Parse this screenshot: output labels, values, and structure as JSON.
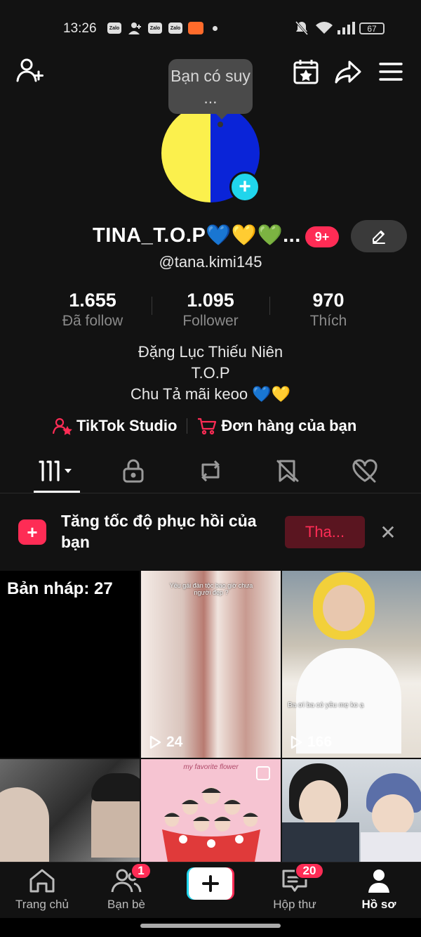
{
  "status_bar": {
    "time": "13:26",
    "apps": [
      "Zalo",
      "Zalo",
      "Zalo"
    ],
    "battery": "67"
  },
  "tooltip": {
    "text": "Bạn có suy ..."
  },
  "profile": {
    "username": "TINA_T.O.P💙💛💚...",
    "notification_badge": "9+",
    "handle": "@tana.kimi145",
    "avatar_colors": [
      "#fbf04d",
      "#0a24d8"
    ]
  },
  "stats": [
    {
      "value": "1.655",
      "label": "Đã follow"
    },
    {
      "value": "1.095",
      "label": "Follower"
    },
    {
      "value": "970",
      "label": "Thích"
    }
  ],
  "bio": [
    "Đặng Lục Thiếu Niên",
    "T.O.P",
    "Chu Tả mãi keoo 💙💛"
  ],
  "links": {
    "studio": "TikTok Studio",
    "orders": "Đơn hàng của bạn"
  },
  "tabs": [
    {
      "icon": "grid-icon",
      "active": true
    },
    {
      "icon": "lock-icon",
      "active": false
    },
    {
      "icon": "repost-icon",
      "active": false
    },
    {
      "icon": "bookmark-icon",
      "active": false
    },
    {
      "icon": "liked-icon",
      "active": false
    }
  ],
  "promo": {
    "text": "Tăng tốc độ phục hồi của bạn",
    "button": "Tha..."
  },
  "grid": {
    "drafts": "Bản nháp: 27",
    "videos": [
      {
        "caption": "Yêu gái đàn tộc bao giờ chưa người đẹp ?",
        "plays": "24"
      },
      {
        "caption": "Ba ơi ba có yêu mẹ ko ạ",
        "plays": "166"
      },
      {
        "caption": "",
        "plays": ""
      },
      {
        "caption": "my favorite flower",
        "plays": ""
      },
      {
        "caption": "",
        "plays": ""
      }
    ]
  },
  "nav": {
    "home": "Trang chủ",
    "friends": "Bạn bè",
    "friends_badge": "1",
    "inbox": "Hộp thư",
    "inbox_badge": "20",
    "profile": "Hồ sơ"
  },
  "colors": {
    "background": "#121212",
    "accent": "#fe2c55",
    "cyan": "#20d5ec"
  }
}
